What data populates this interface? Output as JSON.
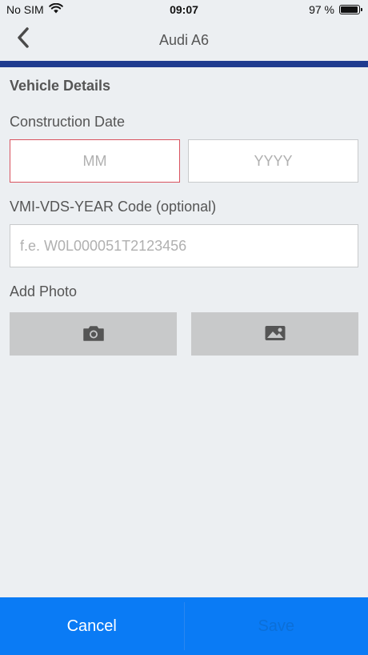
{
  "status_bar": {
    "carrier": "No SIM",
    "time": "09:07",
    "battery_text": "97 %",
    "battery_level": 0.97
  },
  "nav": {
    "title": "Audi A6",
    "back_icon": "chevron-left-icon"
  },
  "form": {
    "section_title": "Vehicle Details",
    "construction_label": "Construction Date",
    "month_placeholder": "MM",
    "year_placeholder": "YYYY",
    "vin_label": "VMI-VDS-YEAR Code (optional)",
    "vin_placeholder": "f.e. W0L000051T2123456",
    "photo_label": "Add Photo",
    "camera_icon": "camera-icon",
    "gallery_icon": "image-icon"
  },
  "actions": {
    "cancel_label": "Cancel",
    "save_label": "Save"
  },
  "colors": {
    "accent_bar": "#1f3b8f",
    "bottom_bar": "#0a7bf5",
    "error_border": "#d9535f",
    "background": "#eceff2"
  }
}
